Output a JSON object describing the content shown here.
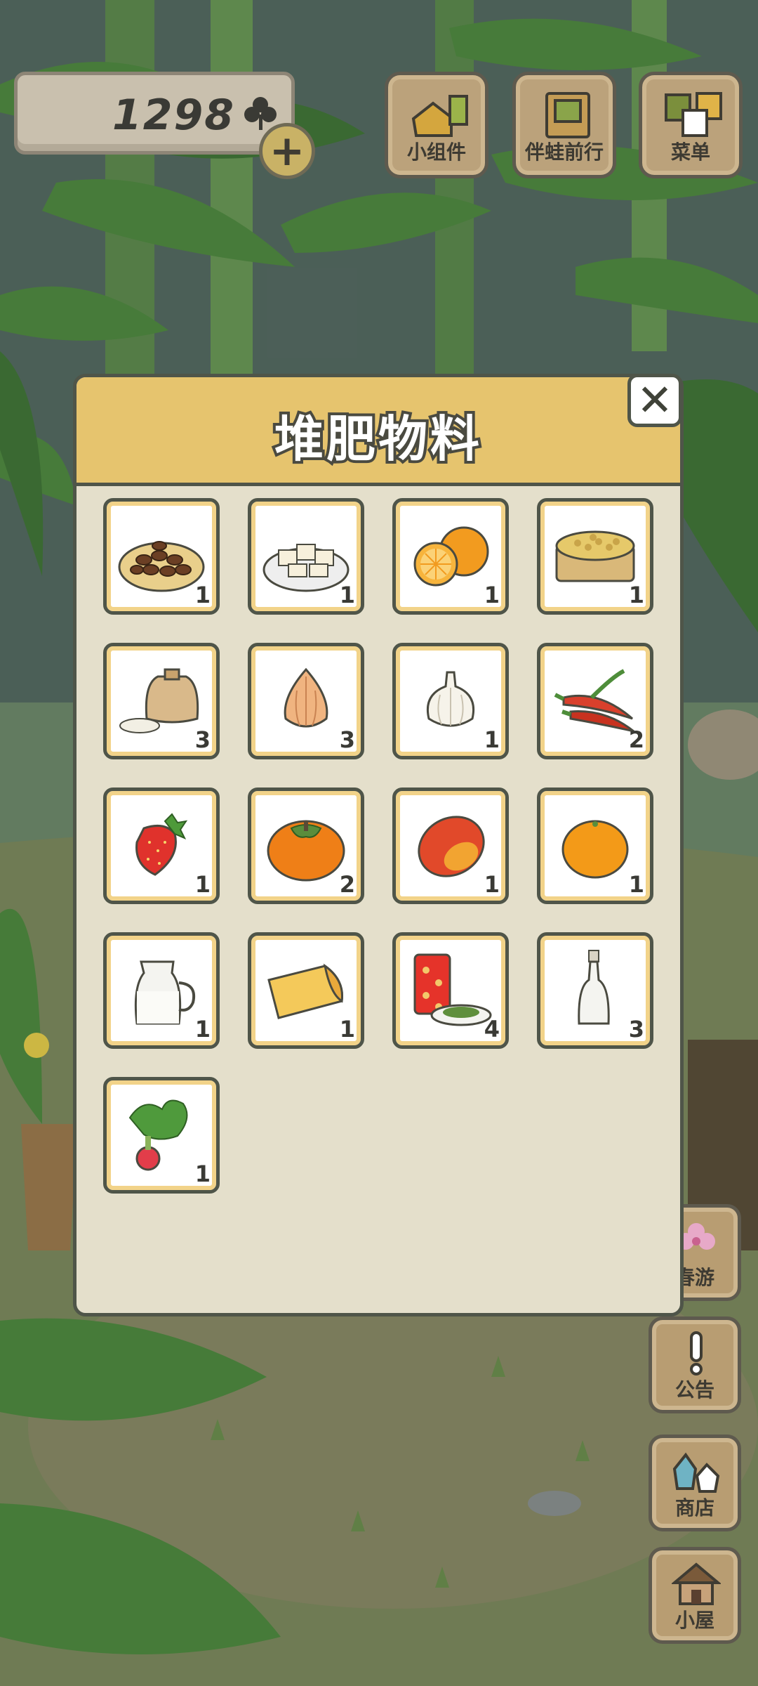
{
  "currency": {
    "amount": "1298",
    "icon": "clover-icon"
  },
  "top_buttons": [
    {
      "label": "小组件",
      "icon": "widget-icon"
    },
    {
      "label": "伴蛙前行",
      "icon": "photo-album-icon"
    },
    {
      "label": "菜单",
      "icon": "menu-icon"
    }
  ],
  "side_buttons": [
    {
      "label": "春游",
      "icon": "sakura-icon"
    },
    {
      "label": "公告",
      "icon": "exclamation-icon"
    },
    {
      "label": "商店",
      "icon": "shop-icon"
    },
    {
      "label": "小屋",
      "icon": "house-icon"
    }
  ],
  "dialog": {
    "title": "堆肥物料",
    "close_label": "✕",
    "items": [
      {
        "icon": "nuts-plate-icon",
        "count": "1"
      },
      {
        "icon": "tofu-plate-icon",
        "count": "1"
      },
      {
        "icon": "orange-icon",
        "count": "1"
      },
      {
        "icon": "soybeans-icon",
        "count": "1"
      },
      {
        "icon": "rice-bag-icon",
        "count": "3"
      },
      {
        "icon": "onion-icon",
        "count": "3"
      },
      {
        "icon": "garlic-icon",
        "count": "1"
      },
      {
        "icon": "chili-pepper-icon",
        "count": "2"
      },
      {
        "icon": "strawberry-icon",
        "count": "1"
      },
      {
        "icon": "persimmon-icon",
        "count": "2"
      },
      {
        "icon": "mango-icon",
        "count": "1"
      },
      {
        "icon": "mandarin-icon",
        "count": "1"
      },
      {
        "icon": "milk-jug-icon",
        "count": "1"
      },
      {
        "icon": "cheese-icon",
        "count": "1"
      },
      {
        "icon": "tea-can-icon",
        "count": "4"
      },
      {
        "icon": "bottle-icon",
        "count": "3"
      },
      {
        "icon": "radish-icon",
        "count": "1"
      }
    ]
  }
}
